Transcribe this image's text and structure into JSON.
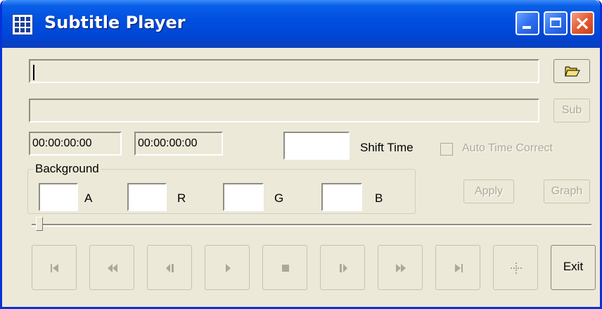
{
  "window": {
    "title": "Subtitle Player"
  },
  "inputs": {
    "video_path": "",
    "subtitle_path": "",
    "time_start": "00:00:00:00",
    "time_end": "00:00:00:00",
    "shift_time": ""
  },
  "buttons": {
    "sub": "Sub",
    "apply": "Apply",
    "graph": "Graph",
    "exit": "Exit"
  },
  "labels": {
    "shift_time": "Shift Time",
    "auto_time_correct": "Auto Time Correct"
  },
  "background": {
    "title": "Background",
    "a_label": "A",
    "r_label": "R",
    "g_label": "G",
    "b_label": "B",
    "a_value": "",
    "r_value": "",
    "g_value": "",
    "b_value": ""
  },
  "seek": {
    "position": 0
  },
  "transport": [
    {
      "icon": "skip-to-start-icon",
      "enabled": false
    },
    {
      "icon": "rewind-icon",
      "enabled": false
    },
    {
      "icon": "step-back-icon",
      "enabled": false
    },
    {
      "icon": "play-icon",
      "enabled": false
    },
    {
      "icon": "stop-icon",
      "enabled": false
    },
    {
      "icon": "step-forward-icon",
      "enabled": false
    },
    {
      "icon": "fast-forward-icon",
      "enabled": false
    },
    {
      "icon": "skip-to-end-icon",
      "enabled": false
    },
    {
      "icon": "move-icon",
      "enabled": false
    },
    {
      "icon": "exit",
      "enabled": true
    }
  ],
  "colors": {
    "titlebar": "#0050e0",
    "face": "#ece9d8",
    "disabled_text": "#aca899",
    "close_button": "#e45b32"
  }
}
